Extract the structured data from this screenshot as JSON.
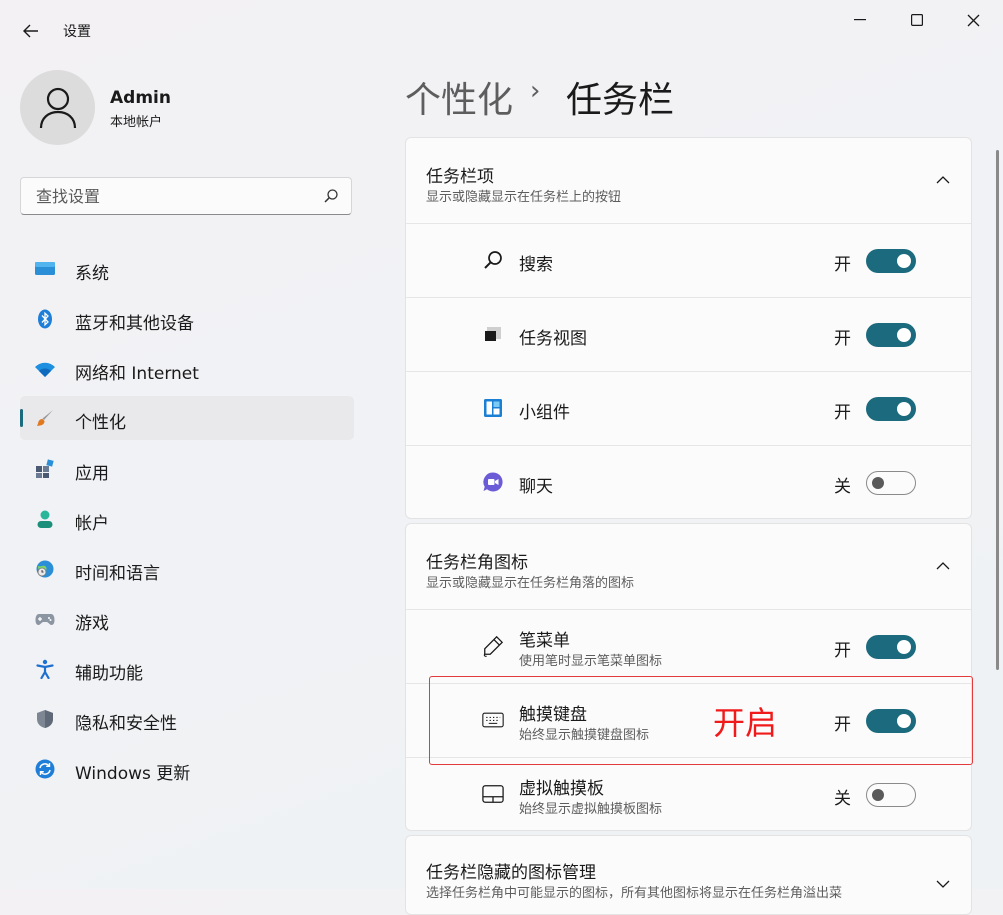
{
  "window": {
    "app_title": "设置",
    "back_label": "←"
  },
  "profile": {
    "name": "Admin",
    "account_type": "本地帐户"
  },
  "search": {
    "placeholder": "查找设置"
  },
  "nav": {
    "items": [
      {
        "label": "系统",
        "icon": "system-icon"
      },
      {
        "label": "蓝牙和其他设备",
        "icon": "bluetooth-icon"
      },
      {
        "label": "网络和 Internet",
        "icon": "wifi-icon"
      },
      {
        "label": "个性化",
        "icon": "brush-icon",
        "selected": true
      },
      {
        "label": "应用",
        "icon": "apps-icon"
      },
      {
        "label": "帐户",
        "icon": "account-icon"
      },
      {
        "label": "时间和语言",
        "icon": "globe-clock-icon"
      },
      {
        "label": "游戏",
        "icon": "gamepad-icon"
      },
      {
        "label": "辅助功能",
        "icon": "accessibility-icon"
      },
      {
        "label": "隐私和安全性",
        "icon": "shield-icon"
      },
      {
        "label": "Windows 更新",
        "icon": "update-icon"
      }
    ]
  },
  "header": {
    "breadcrumb_parent": "个性化",
    "separator": "›",
    "page_title": "任务栏"
  },
  "sections": {
    "taskbar_items": {
      "title": "任务栏项",
      "subtitle": "显示或隐藏显示在任务栏上的按钮",
      "rows": [
        {
          "label": "搜索",
          "state_label": "开",
          "on": true,
          "icon": "search-icon"
        },
        {
          "label": "任务视图",
          "state_label": "开",
          "on": true,
          "icon": "task-view-icon"
        },
        {
          "label": "小组件",
          "state_label": "开",
          "on": true,
          "icon": "widgets-icon"
        },
        {
          "label": "聊天",
          "state_label": "关",
          "on": false,
          "icon": "chat-icon"
        }
      ]
    },
    "corner_icons": {
      "title": "任务栏角图标",
      "subtitle": "显示或隐藏显示在任务栏角落的图标",
      "rows": [
        {
          "label": "笔菜单",
          "sublabel": "使用笔时显示笔菜单图标",
          "state_label": "开",
          "on": true,
          "icon": "pen-icon"
        },
        {
          "label": "触摸键盘",
          "sublabel": "始终显示触摸键盘图标",
          "state_label": "开",
          "on": true,
          "icon": "keyboard-icon"
        },
        {
          "label": "虚拟触摸板",
          "sublabel": "始终显示虚拟触摸板图标",
          "state_label": "关",
          "on": false,
          "icon": "touchpad-icon"
        }
      ]
    },
    "hidden_icons": {
      "title": "任务栏隐藏的图标管理",
      "subtitle": "选择任务栏角中可能显示的图标，所有其他图标将显示在任务栏角溢出菜"
    }
  },
  "annotation": {
    "text": "开启",
    "color": "#f01a1a"
  },
  "colors": {
    "accent": "#1b6a7d"
  }
}
